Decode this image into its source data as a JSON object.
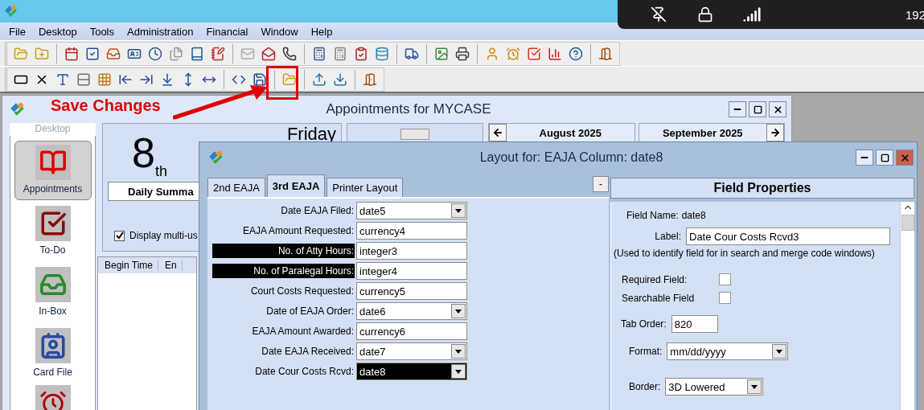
{
  "connection_bar": {
    "text": "192"
  },
  "menu": [
    "File",
    "Desktop",
    "Tools",
    "Administration",
    "Financial",
    "Window",
    "Help"
  ],
  "annotation": {
    "text": "Save Changes"
  },
  "appointments_window": {
    "title": "Appointments for MYCASE",
    "sidebar": {
      "header": "Desktop",
      "items": [
        {
          "label": "Appointments",
          "kind": "appointments",
          "selected": true
        },
        {
          "label": "To-Do",
          "kind": "todo",
          "selected": false
        },
        {
          "label": "In-Box",
          "kind": "inbox",
          "selected": false
        },
        {
          "label": "Card File",
          "kind": "cardfile",
          "selected": false
        }
      ]
    },
    "day_number": "8",
    "day_suffix": "th",
    "weekday": "Friday",
    "summary_button": "Daily Summa",
    "multi_user": {
      "label": "Display multi-us",
      "checked": true
    },
    "columns": [
      "Begin Time",
      "En"
    ],
    "months": [
      "August 2025",
      "September 2025"
    ]
  },
  "layout_dialog": {
    "title": "Layout for: EAJA Column: date8",
    "tabs": [
      {
        "label": "2nd EAJA",
        "selected": false
      },
      {
        "label": "3rd EAJA",
        "selected": true
      },
      {
        "label": "Printer Layout",
        "selected": false
      }
    ],
    "collapse_button": "-",
    "fields": [
      {
        "label": "Date EAJA Filed:",
        "value": "date5",
        "kind": "dropdown",
        "highlighted": false,
        "selected": false
      },
      {
        "label": "EAJA Amount Requested:",
        "value": "currency4",
        "kind": "text",
        "highlighted": false,
        "selected": false
      },
      {
        "label": "No. of Atty Hours:",
        "value": "integer3",
        "kind": "text",
        "highlighted": true,
        "selected": false
      },
      {
        "label": "No. of Paralegal Hours:",
        "value": "integer4",
        "kind": "text",
        "highlighted": true,
        "selected": false
      },
      {
        "label": "Court Costs Requested:",
        "value": "currency5",
        "kind": "text",
        "highlighted": false,
        "selected": false
      },
      {
        "label": "Date of EAJA Order:",
        "value": "date6",
        "kind": "dropdown",
        "highlighted": false,
        "selected": false
      },
      {
        "label": "EAJA Amount Awarded:",
        "value": "currency6",
        "kind": "text",
        "highlighted": false,
        "selected": false
      },
      {
        "label": "Date EAJA Received:",
        "value": "date7",
        "kind": "dropdown",
        "highlighted": false,
        "selected": false
      },
      {
        "label": "Date Cour Costs Rcvd:",
        "value": "date8",
        "kind": "dropdown",
        "highlighted": false,
        "selected": true
      }
    ],
    "properties": {
      "header": "Field Properties",
      "field_name": {
        "label": "Field Name:",
        "value": "date8"
      },
      "label": {
        "label": "Label:",
        "value": "Date Cour Costs Rcvd3"
      },
      "note": "(Used to identify field for in search and merge code windows)",
      "checks": [
        {
          "label": "Required Field:",
          "checked": false
        },
        {
          "label": "Searchable Field",
          "checked": false
        }
      ],
      "tab_order": {
        "label": "Tab Order:",
        "value": "820"
      },
      "format": {
        "label": "Format:",
        "value": "mm/dd/yyyy"
      },
      "border": {
        "label": "Border:",
        "value": "3D Lowered"
      }
    }
  }
}
